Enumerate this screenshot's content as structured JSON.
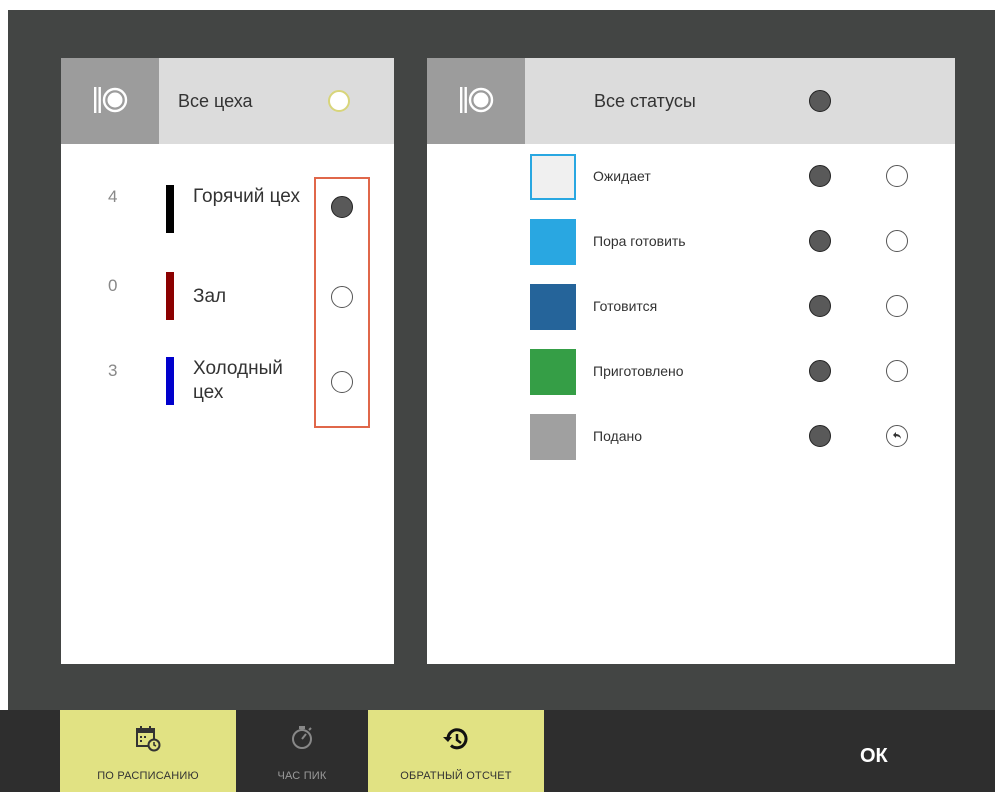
{
  "workshops": {
    "all_label": "Все цеха",
    "items": [
      {
        "count": "4",
        "name": "Горячий цех",
        "color": "#000000",
        "selected": true
      },
      {
        "count": "0",
        "name": "Зал",
        "color": "#8b0000",
        "selected": false
      },
      {
        "count": "3",
        "name": "Холодный цех",
        "color": "#0000cc",
        "selected": false
      }
    ]
  },
  "statuses": {
    "all_label": "Все статусы",
    "items": [
      {
        "name": "Ожидает",
        "color": "#f0f0f0"
      },
      {
        "name": "Пора готовить",
        "color": "#29a7e1"
      },
      {
        "name": "Готовится",
        "color": "#25649a"
      },
      {
        "name": "Приготовлено",
        "color": "#359e46"
      },
      {
        "name": "Подано",
        "color": "#a0a0a0"
      }
    ]
  },
  "toolbar": {
    "schedule_label": "ПО РАСПИСАНИЮ",
    "peak_label": "ЧАС ПИК",
    "countdown_label": "ОБРАТНЫЙ ОТСЧЕТ",
    "ok_label": "ОК"
  },
  "colors": {
    "overlay": "#434544",
    "header": "#dcdcdc",
    "icon_box": "#9c9c9c",
    "active_button": "#e1e283",
    "highlight": "#e0674a"
  },
  "icons": {
    "panel_header": "plate-fork-knife-icon",
    "schedule": "calendar-clock-icon",
    "peak": "stopwatch-icon",
    "countdown": "history-icon",
    "served_reverse": "undo-icon"
  }
}
